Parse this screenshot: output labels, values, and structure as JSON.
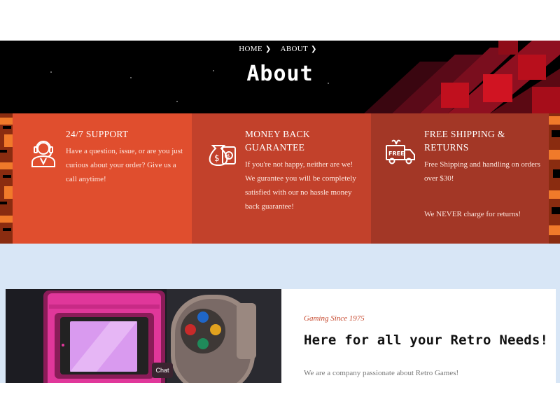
{
  "breadcrumb": {
    "items": [
      {
        "label": "HOME"
      },
      {
        "label": "ABOUT"
      }
    ]
  },
  "hero": {
    "title": "About"
  },
  "features": [
    {
      "icon": "headset-support-icon",
      "heading": "24/7 SUPPORT",
      "description": "Have a question, issue, or are you just curious about your order? Give us a call anytime!"
    },
    {
      "icon": "money-bag-icon",
      "heading": "MONEY BACK GUARANTEE",
      "description": "If you're not happy, neither are we! We gurantee you will be completely satisfied with our no hassle money back guarantee!"
    },
    {
      "icon": "free-shipping-truck-icon",
      "icon_text": "FREE",
      "heading": "FREE SHIPPING & RETURNS",
      "description": "Free Shipping and handling on orders over $30!",
      "note": "We NEVER charge for returns!"
    }
  ],
  "about": {
    "tagline": "Gaming Since 1975",
    "title": "Here for all your Retro Needs!",
    "intro": "We are a company passionate about Retro Games!"
  },
  "chat": {
    "label": "Chat"
  },
  "colors": {
    "accent": "#e04e2e",
    "feature_2": "#c2412b",
    "feature_3": "#a33726",
    "band": "#d8e6f6"
  }
}
